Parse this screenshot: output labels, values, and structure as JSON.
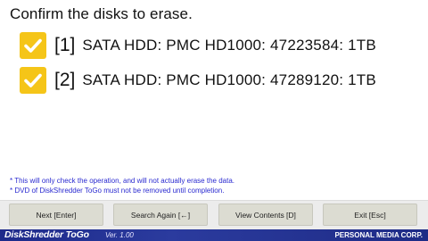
{
  "title": "Confirm the disks to erase.",
  "disks": [
    {
      "index": "[1]",
      "description": "SATA HDD: PMC HD1000: 47223584: 1TB",
      "checked": true
    },
    {
      "index": "[2]",
      "description": "SATA HDD: PMC HD1000: 47289120: 1TB",
      "checked": true
    }
  ],
  "notes": [
    "* This will only check the operation, and will not actually erase the data.",
    "* DVD of DiskShredder ToGo must not be removed until completion."
  ],
  "buttons": {
    "next": "Next [Enter]",
    "search_again": "Search Again [←]",
    "view_contents": "View Contents [D]",
    "exit": "Exit [Esc]"
  },
  "footer": {
    "brand": "DiskShredder ToGo",
    "version": "Ver. 1.00",
    "company": "PERSONAL MEDIA CORP."
  },
  "colors": {
    "checkbox": "#f5c518",
    "notes_text": "#2a2ad0",
    "footer_bg": "#1d2a8a",
    "button_bg": "#dcdcd2"
  },
  "icons": {
    "checkbox": "checkmark-icon"
  }
}
